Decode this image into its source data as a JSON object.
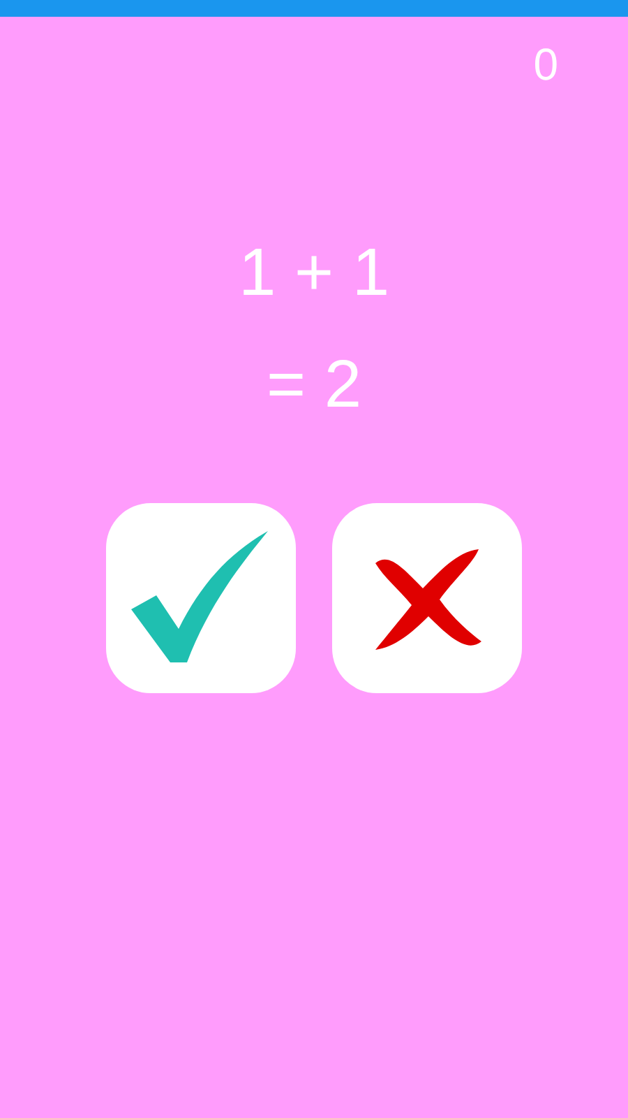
{
  "score": "0",
  "equation": "1 + 1",
  "result": "= 2"
}
